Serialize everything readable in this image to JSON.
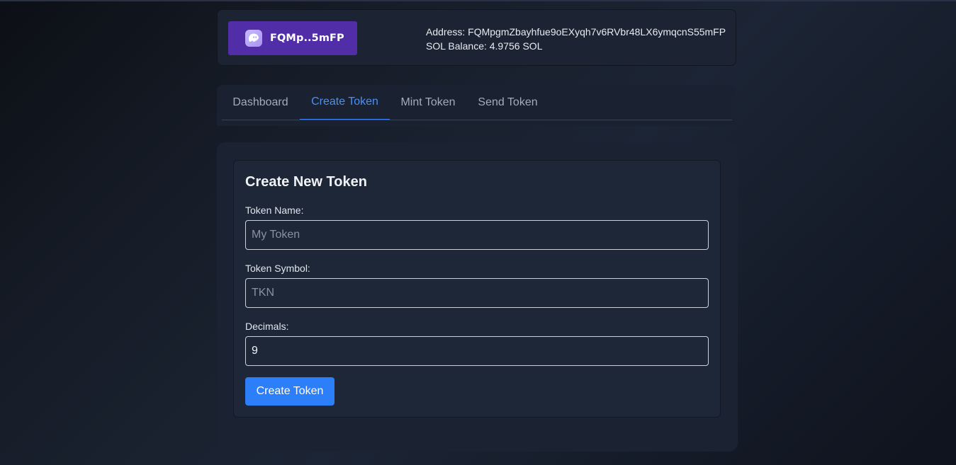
{
  "wallet": {
    "button_label": "FQMp..5mFP",
    "icon": "phantom-ghost-icon",
    "address_text": "Address: FQMpgmZbayhfue9oEXyqh7v6RVbr48LX6ymqcnS55mFP",
    "balance_text": "SOL Balance: 4.9756 SOL"
  },
  "tabs": [
    {
      "label": "Dashboard",
      "active": false
    },
    {
      "label": "Create Token",
      "active": true
    },
    {
      "label": "Mint Token",
      "active": false
    },
    {
      "label": "Send Token",
      "active": false
    }
  ],
  "form": {
    "title": "Create New Token",
    "fields": [
      {
        "label": "Token Name:",
        "placeholder": "My Token",
        "value": ""
      },
      {
        "label": "Token Symbol:",
        "placeholder": "TKN",
        "value": ""
      },
      {
        "label": "Decimals:",
        "placeholder": "",
        "value": "9"
      }
    ],
    "submit_label": "Create Token"
  },
  "colors": {
    "wallet_button": "#512da8",
    "active_tab": "#3b82f6",
    "primary_button": "#2d7ff9",
    "card_background": "#1c2433"
  }
}
